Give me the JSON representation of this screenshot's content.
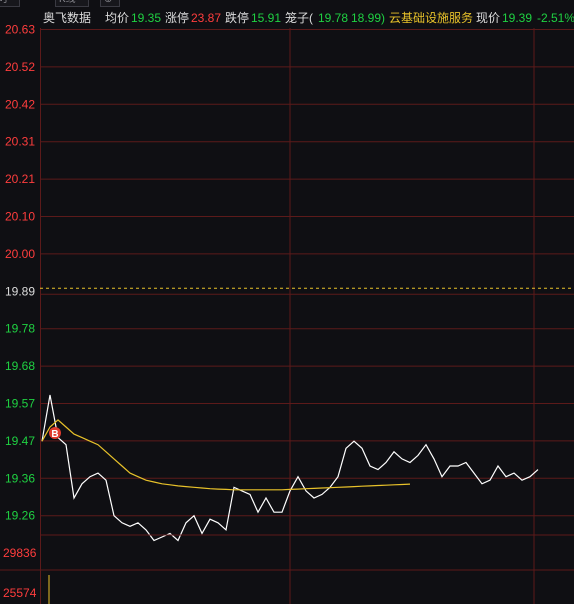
{
  "tabs": [
    "时",
    "K线",
    "⊕"
  ],
  "header": {
    "stock_name": "奥飞数据",
    "avg_label": "均价",
    "avg_value": "19.35",
    "limit_up_label": "涨停",
    "limit_up_value": "23.87",
    "limit_down_label": "跌停",
    "limit_down_value": "15.91",
    "chips_label": "笼子(",
    "chips_low": "19.78",
    "chips_high": "18.99)",
    "sector": "云基础设施服务",
    "price_label": "现价",
    "price_value": "19.39",
    "change_pct": "-2.51%"
  },
  "chart_data": {
    "type": "line",
    "y_ticks": [
      "20.63",
      "20.52",
      "20.42",
      "20.31",
      "20.21",
      "20.10",
      "20.00",
      "19.89",
      "19.78",
      "19.68",
      "19.57",
      "19.47",
      "19.36",
      "19.26"
    ],
    "prev_close": 19.89,
    "volume_ticks": [
      "29836",
      "25574"
    ],
    "marker": "B",
    "ylim": [
      19.2,
      20.65
    ],
    "series": [
      {
        "values": [
          19.47,
          19.6,
          19.48,
          19.46,
          19.31,
          19.35,
          19.37,
          19.38,
          19.36,
          19.26,
          19.24,
          19.23,
          19.24,
          19.22,
          19.19,
          19.2,
          19.21,
          19.19,
          19.24,
          19.26,
          19.21,
          19.25,
          19.24,
          19.22,
          19.34,
          19.33,
          19.32,
          19.27,
          19.31,
          19.27,
          19.27,
          19.33,
          19.37,
          19.33,
          19.31,
          19.32,
          19.34,
          19.37,
          19.45,
          19.47,
          19.45,
          19.4,
          19.39,
          19.41,
          19.44,
          19.42,
          19.41,
          19.43,
          19.46,
          19.42,
          19.37,
          19.4,
          19.4,
          19.41,
          19.38,
          19.35,
          19.36,
          19.4,
          19.37,
          19.38,
          19.36,
          19.37,
          19.39
        ],
        "color": "#ffffff"
      },
      {
        "values": [
          19.47,
          19.51,
          19.53,
          19.51,
          19.49,
          19.48,
          19.47,
          19.46,
          19.44,
          19.42,
          19.4,
          19.38,
          19.37,
          19.36,
          19.355,
          19.35,
          19.347,
          19.344,
          19.342,
          19.34,
          19.338,
          19.336,
          19.335,
          19.334,
          19.333,
          19.333,
          19.333,
          19.333,
          19.333,
          19.333,
          19.333,
          19.334,
          19.335,
          19.336,
          19.337,
          19.338,
          19.339,
          19.34,
          19.341,
          19.342,
          19.343,
          19.344,
          19.345,
          19.346,
          19.347,
          19.348,
          19.349
        ],
        "color": "#e8c22a"
      }
    ],
    "colors": {
      "grid": "#5c1a1a",
      "up_label": "#ff3d3d",
      "down_label": "#1fd142",
      "prev_close_line": "#e8c22a",
      "marker_bg": "#e03b2e",
      "volume_bar": "#e8c22a"
    }
  }
}
